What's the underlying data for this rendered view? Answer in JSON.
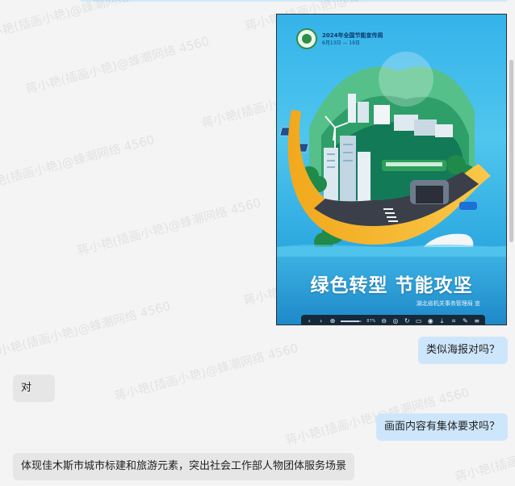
{
  "watermark_text": "蒋小艳(插画小艳)@蜂潮网络 4560",
  "poster": {
    "event_title": "2024年全国节能宣传周",
    "event_dates": "6月13日 — 19日",
    "slogan": "绿色转型 节能攻坚",
    "issuer": "湖北省机关事务管理局 宣",
    "toolbar": {
      "prev_icon": "‹",
      "next_icon": "›",
      "zoom_percent": "87%",
      "zoom_level": 0.87
    }
  },
  "messages": [
    {
      "side": "me",
      "text": "类似海报对吗？"
    },
    {
      "side": "other",
      "text": "对"
    },
    {
      "side": "me",
      "text": "画面内容有集体要求吗？"
    },
    {
      "side": "other",
      "text": "体现佳木斯市城市标建和旅游元素，突出社会工作部人物团体服务场景"
    }
  ],
  "colors": {
    "my_bubble": "#cde6fb",
    "other_bubble": "#e6e6e6",
    "background": "#f4f4f4"
  }
}
